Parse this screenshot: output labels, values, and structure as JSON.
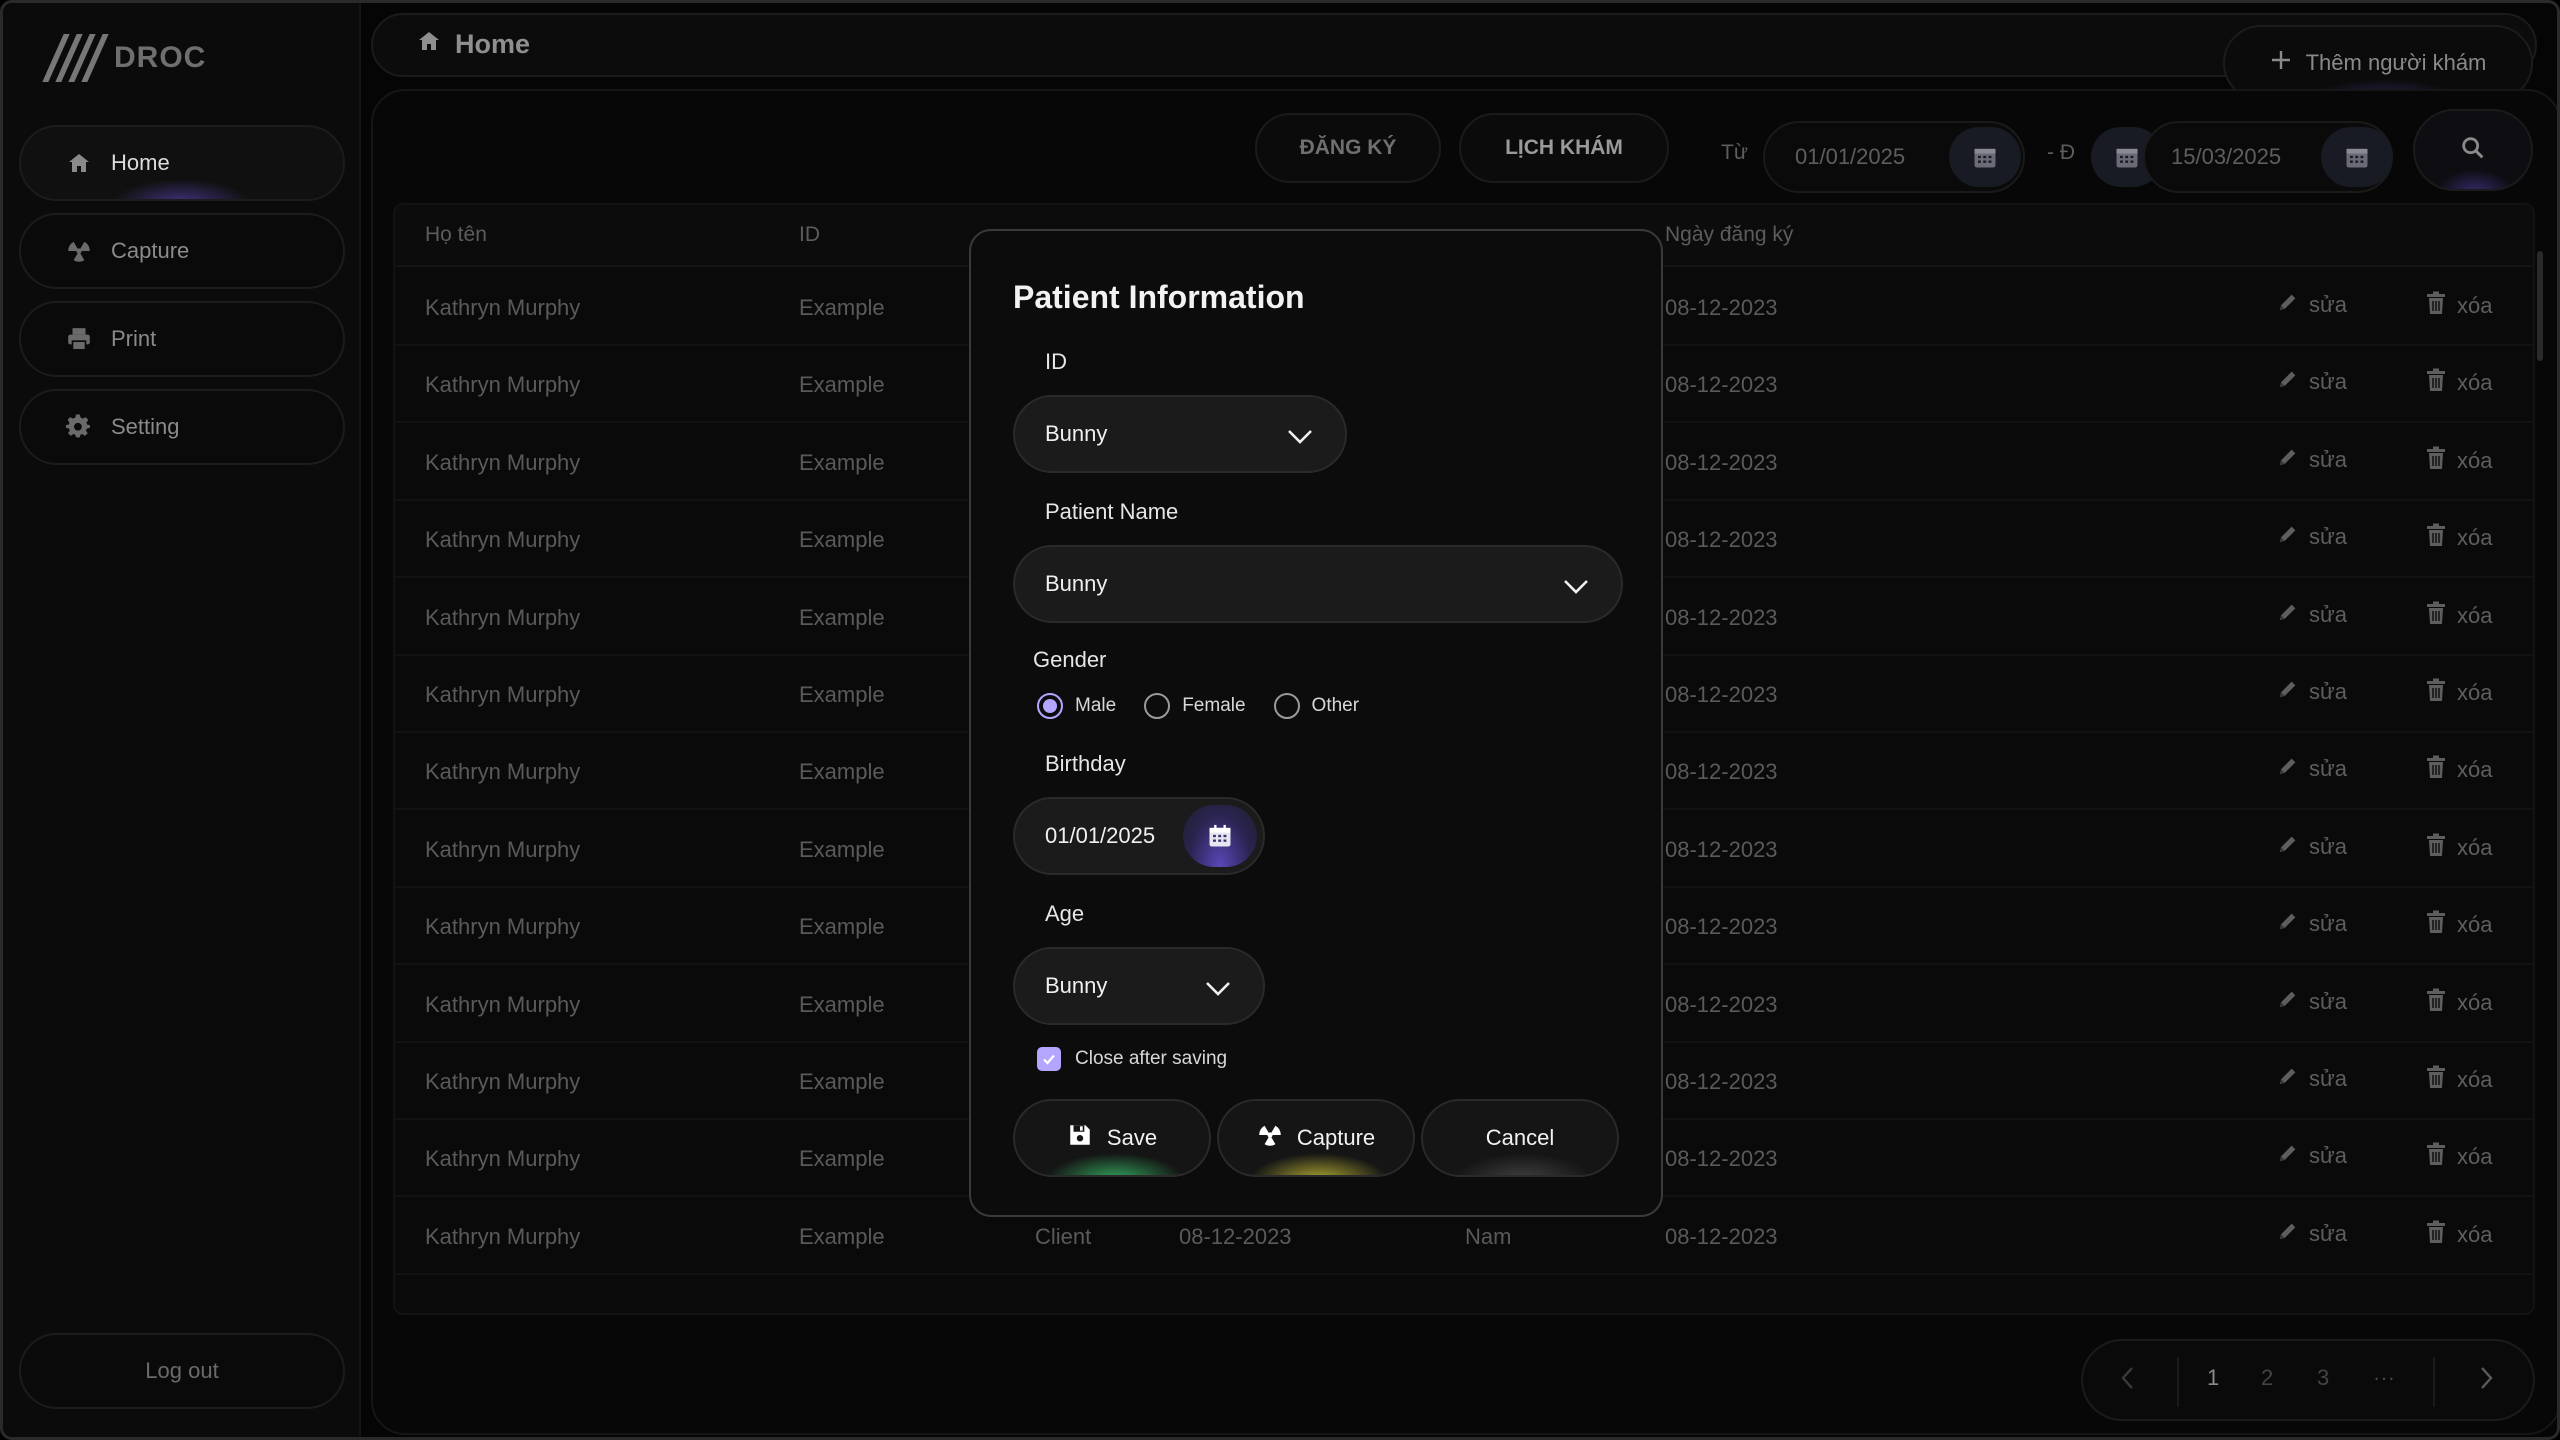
{
  "app": {
    "logo_text": "DROC"
  },
  "sidebar": {
    "items": [
      {
        "label": "Home",
        "icon": "home-icon",
        "active": true
      },
      {
        "label": "Capture",
        "icon": "radiation-icon",
        "active": false
      },
      {
        "label": "Print",
        "icon": "printer-icon",
        "active": false
      },
      {
        "label": "Setting",
        "icon": "gear-icon",
        "active": false
      }
    ],
    "logout_label": "Log out"
  },
  "header": {
    "title": "Home",
    "add_label": "Thêm người khám"
  },
  "toolbar": {
    "tab_register": "ĐĂNG KÝ",
    "tab_schedule": "LỊCH KHÁM",
    "from_label": "Từ",
    "from_date": "01/01/2025",
    "separator": "- Đ",
    "to_date": "15/03/2025"
  },
  "table": {
    "columns": [
      "Họ tên",
      "ID",
      "",
      "",
      "",
      "Ngày đăng ký"
    ],
    "rows": [
      {
        "name": "Kathryn Murphy",
        "id": "Example",
        "reg_date": "08-12-2023"
      },
      {
        "name": "Kathryn Murphy",
        "id": "Example",
        "reg_date": "08-12-2023"
      },
      {
        "name": "Kathryn Murphy",
        "id": "Example",
        "reg_date": "08-12-2023"
      },
      {
        "name": "Kathryn Murphy",
        "id": "Example",
        "reg_date": "08-12-2023"
      },
      {
        "name": "Kathryn Murphy",
        "id": "Example",
        "reg_date": "08-12-2023"
      },
      {
        "name": "Kathryn Murphy",
        "id": "Example",
        "reg_date": "08-12-2023"
      },
      {
        "name": "Kathryn Murphy",
        "id": "Example",
        "reg_date": "08-12-2023"
      },
      {
        "name": "Kathryn Murphy",
        "id": "Example",
        "reg_date": "08-12-2023"
      },
      {
        "name": "Kathryn Murphy",
        "id": "Example",
        "reg_date": "08-12-2023"
      },
      {
        "name": "Kathryn Murphy",
        "id": "Example",
        "reg_date": "08-12-2023"
      },
      {
        "name": "Kathryn Murphy",
        "id": "Example",
        "reg_date": "08-12-2023"
      },
      {
        "name": "Kathryn Murphy",
        "id": "Example",
        "reg_date": "08-12-2023"
      },
      {
        "name": "Kathryn Murphy",
        "id": "Example",
        "type": "Client",
        "birthday": "08-12-2023",
        "gender": "Nam",
        "reg_date": "08-12-2023"
      }
    ],
    "edit_label": "sửa",
    "delete_label": "xóa"
  },
  "pagination": {
    "pages": [
      "1",
      "2",
      "3",
      "···"
    ],
    "current": "1"
  },
  "modal": {
    "title": "Patient Information",
    "id_label": "ID",
    "id_value": "Bunny",
    "name_label": "Patient Name",
    "name_value": "Bunny",
    "gender_label": "Gender",
    "gender_options": [
      "Male",
      "Female",
      "Other"
    ],
    "gender_selected": "Male",
    "birthday_label": "Birthday",
    "birthday_value": "01/01/2025",
    "age_label": "Age",
    "age_value": "Bunny",
    "close_after_saving_label": "Close after saving",
    "close_after_saving_checked": true,
    "save_label": "Save",
    "capture_label": "Capture",
    "cancel_label": "Cancel"
  },
  "colors": {
    "accent": "#b4a6ff",
    "save_glow": "#3cdc78",
    "capture_glow": "#e6dc3c"
  }
}
